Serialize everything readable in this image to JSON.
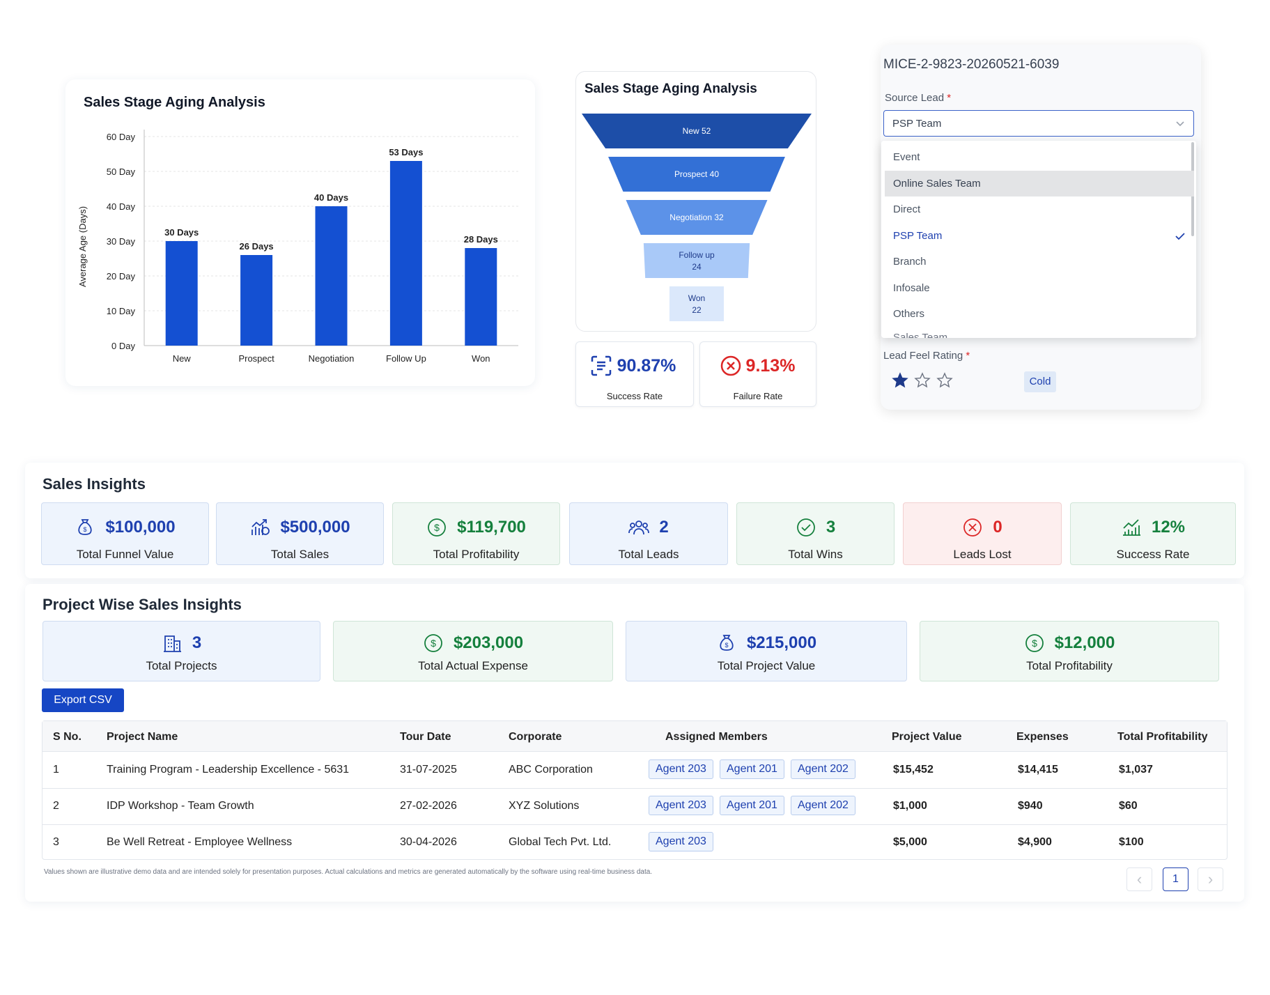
{
  "aging_chart": {
    "title": "Sales Stage Aging Analysis",
    "chart_data": {
      "type": "bar",
      "categories": [
        "New",
        "Prospect",
        "Negotiation",
        "Follow Up",
        "Won"
      ],
      "values": [
        30,
        26,
        40,
        53,
        28
      ],
      "data_labels": [
        "30 Days",
        "26 Days",
        "40 Days",
        "53 Days",
        "28 Days"
      ],
      "ylabel": "Average Age (Days)",
      "yticks": [
        "0 Day",
        "10 Day",
        "20 Day",
        "30 Day",
        "40 Day",
        "50 Day",
        "60 Day"
      ],
      "ylim": [
        0,
        60
      ],
      "grid": true,
      "color": "#1450d2"
    }
  },
  "funnel_chart": {
    "title": "Sales Stage Aging Analysis",
    "chart_data": {
      "type": "funnel",
      "stages": [
        {
          "label": "New 52",
          "value": 52,
          "color": "#1d4ea8"
        },
        {
          "label": "Prospect 40",
          "value": 40,
          "color": "#3370d6"
        },
        {
          "label": "Negotiation 32",
          "value": 32,
          "color": "#5c92e8"
        },
        {
          "label": "Follow up",
          "label2": "24",
          "value": 24,
          "color": "#a9c9f8"
        },
        {
          "label": "Won",
          "label2": "22",
          "value": 22,
          "color": "#dbe8fb"
        }
      ]
    },
    "success_rate": "90.87%",
    "success_label": "Success Rate",
    "failure_rate": "9.13%",
    "failure_label": "Failure Rate"
  },
  "lead_form": {
    "id": "MICE-2-9823-20260521-6039",
    "source_label": "Source Lead",
    "required_mark": "*",
    "source_value": "PSP Team",
    "options": [
      "Event",
      "Online Sales Team",
      "Direct",
      "PSP Team",
      "Branch",
      "Infosale",
      "Others"
    ],
    "partial_option": "Sales Team",
    "rating_label": "Lead Feel Rating",
    "rating": 1,
    "rating_max": 3,
    "temperature_badge": "Cold"
  },
  "sales_insights": {
    "title": "Sales Insights",
    "kpis": [
      {
        "value": "$100,000",
        "label": "Total Funnel Value"
      },
      {
        "value": "$500,000",
        "label": "Total Sales"
      },
      {
        "value": "$119,700",
        "label": "Total Profitability"
      },
      {
        "value": "2",
        "label": "Total Leads"
      },
      {
        "value": "3",
        "label": "Total Wins"
      },
      {
        "value": "0",
        "label": "Leads Lost"
      },
      {
        "value": "12%",
        "label": "Success Rate"
      }
    ]
  },
  "project_insights": {
    "title": "Project Wise Sales Insights",
    "kpis": [
      {
        "value": "3",
        "label": "Total Projects"
      },
      {
        "value": "$203,000",
        "label": "Total Actual Expense"
      },
      {
        "value": "$215,000",
        "label": "Total Project Value"
      },
      {
        "value": "$12,000",
        "label": "Total Profitability"
      }
    ],
    "export_label": "Export CSV",
    "columns": [
      "S No.",
      "Project Name",
      "Tour Date",
      "Corporate",
      "Assigned Members",
      "Project Value",
      "Expenses",
      "Total Profitability"
    ],
    "rows": [
      {
        "sno": "1",
        "name": "Training Program - Leadership Excellence - 5631",
        "date": "31-07-2025",
        "corporate": "ABC Corporation",
        "members": [
          "Agent 203",
          "Agent 201",
          "Agent 202"
        ],
        "value": "$15,452",
        "expenses": "$14,415",
        "profit": "$1,037"
      },
      {
        "sno": "2",
        "name": "IDP Workshop - Team Growth",
        "date": "27-02-2026",
        "corporate": "XYZ Solutions",
        "members": [
          "Agent 203",
          "Agent 201",
          "Agent 202"
        ],
        "value": "$1,000",
        "expenses": "$940",
        "profit": "$60"
      },
      {
        "sno": "3",
        "name": "Be Well Retreat - Employee Wellness",
        "date": "30-04-2026",
        "corporate": "Global Tech Pvt. Ltd.",
        "members": [
          "Agent 203"
        ],
        "value": "$5,000",
        "expenses": "$4,900",
        "profit": "$100"
      }
    ],
    "disclaimer": "Values shown are illustrative demo data and are intended solely for presentation purposes. Actual calculations and metrics are generated automatically by the software using real-time business data.",
    "pagination": {
      "prev": "‹",
      "current": "1",
      "next": "›"
    }
  },
  "icons": {
    "money-bag": "money-bag-icon",
    "growth": "growth-chart-icon",
    "dollar": "dollar-circle-icon",
    "users": "users-icon",
    "check": "check-circle-icon",
    "x": "x-circle-icon",
    "trend": "trend-chart-icon",
    "building": "building-icon"
  }
}
